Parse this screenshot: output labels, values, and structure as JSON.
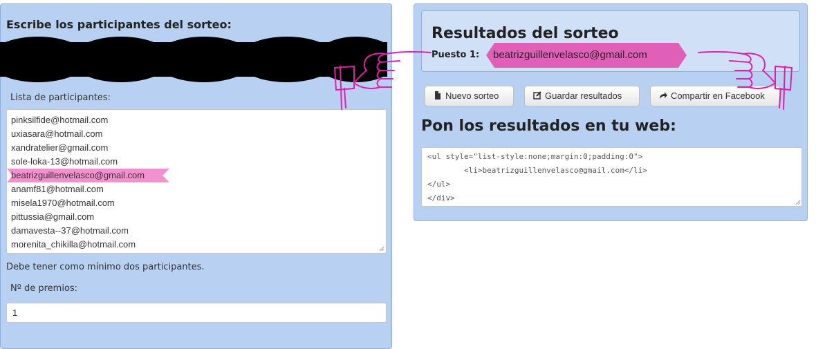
{
  "left_panel": {
    "title": "Escribe los participantes del sorteo:",
    "list_label": "Lista de participantes:",
    "participants": [
      "pinksilfide@hotmail.com",
      "uxiasara@hotmail.com",
      "xandratelier@gmail.com",
      "sole-loka-13@hotmail.com",
      "beatrizguillenvelasco@gmail.com",
      "anamf81@hotmail.com",
      "misela1970@hotmail.com",
      "pittussia@gmail.com",
      "damavesta--37@hotmail.com",
      "morenita_chikilla@hotmail.com"
    ],
    "highlighted_index": 4,
    "min_hint": "Debe tener como mínimo dos participantes.",
    "prizes_label": "Nº de premios:",
    "prizes_value": "1"
  },
  "results": {
    "title": "Resultados del sorteo",
    "puesto_label": "Puesto 1:",
    "winner": "beatrizguillenvelasco@gmail.com"
  },
  "buttons": {
    "new": "Nuevo sorteo",
    "save": "Guardar resultados",
    "share": "Compartir en Facebook"
  },
  "embed": {
    "title": "Pon los resultados en tu web:",
    "code": "<ul style=\"list-style:none;margin:0;padding:0\">\n        <li>beatrizguillenvelasco@gmail.com</li>\n</ul>\n</div>"
  },
  "colors": {
    "panel_bg": "#b8d0f2",
    "highlight": "#f390d0",
    "ribbon": "#e060b8",
    "hand_ink": "#e020a8"
  },
  "icons": {
    "new": "file-icon",
    "save": "edit-icon",
    "share": "share-arrow-icon"
  }
}
